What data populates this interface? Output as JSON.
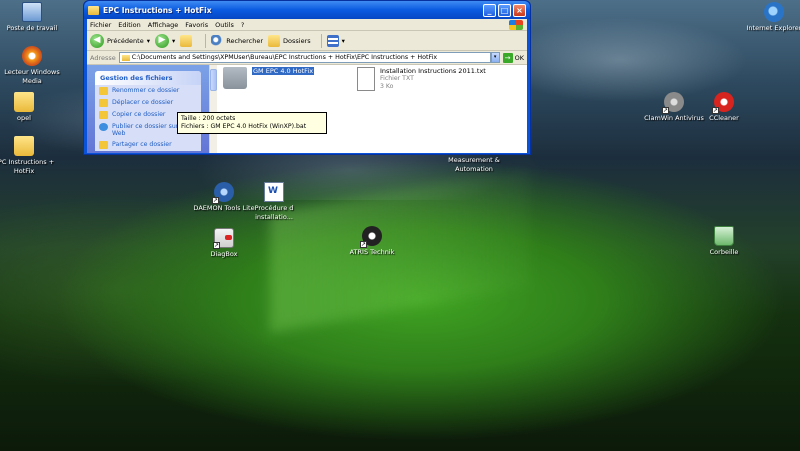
{
  "desktop": {
    "icons": [
      {
        "label": "Poste de travail",
        "icon": "computer-icon"
      },
      {
        "label": "Lecteur Windows Media",
        "icon": "media-player-icon"
      },
      {
        "label": "opel",
        "icon": "folder-icon"
      },
      {
        "label": "EPC Instructions + HotFix",
        "icon": "folder-icon"
      },
      {
        "label": "Internet Explorer",
        "icon": "internet-explorer-icon"
      },
      {
        "label": "ClamWin Antivirus",
        "icon": "clamwin-icon"
      },
      {
        "label": "CCleaner",
        "icon": "ccleaner-icon"
      },
      {
        "label": "Measurement & Automation",
        "icon": "app-icon"
      },
      {
        "label": "DAEMON Tools Lite",
        "icon": "daemon-tools-icon"
      },
      {
        "label": "Procédure d installatio...",
        "icon": "word-document-icon"
      },
      {
        "label": "DiagBox",
        "icon": "diagbox-icon"
      },
      {
        "label": "ATRIS Technik",
        "icon": "atris-icon"
      },
      {
        "label": "Corbeille",
        "icon": "recycle-bin-icon"
      }
    ]
  },
  "window": {
    "title": "EPC Instructions + HotFix",
    "buttons": {
      "minimize": "_",
      "maximize": "□",
      "close": "×"
    },
    "menu": [
      "Fichier",
      "Edition",
      "Affichage",
      "Favoris",
      "Outils",
      "?"
    ],
    "toolbar": {
      "back": "Précédente",
      "back_glyph": "◀",
      "forward_glyph": "▶",
      "dropdown_glyph": "▾",
      "search": "Rechercher",
      "folders": "Dossiers"
    },
    "address": {
      "label": "Adresse",
      "value": "C:\\Documents and Settings\\XPMUser\\Bureau\\EPC Instructions + HotFix\\EPC Instructions + HotFix",
      "go_label": "OK",
      "go_glyph": "→"
    },
    "task_pane": {
      "header": "Gestion des fichiers",
      "items": [
        "Renommer ce dossier",
        "Déplacer ce dossier",
        "Copier ce dossier",
        "Publier ce dossier sur le Web",
        "Partager ce dossier"
      ]
    },
    "files": [
      {
        "name": "GM EPC 4.0 HotFix",
        "type": "",
        "size": "",
        "selected": true
      },
      {
        "name": "Installation Instructions 2011.txt",
        "type": "Fichier TXT",
        "size": "3 Ko",
        "selected": false
      }
    ],
    "tooltip": {
      "line1": "Taille : 200 octets",
      "line2": "Fichiers : GM EPC 4.0 HotFix (WinXP).bat"
    }
  }
}
